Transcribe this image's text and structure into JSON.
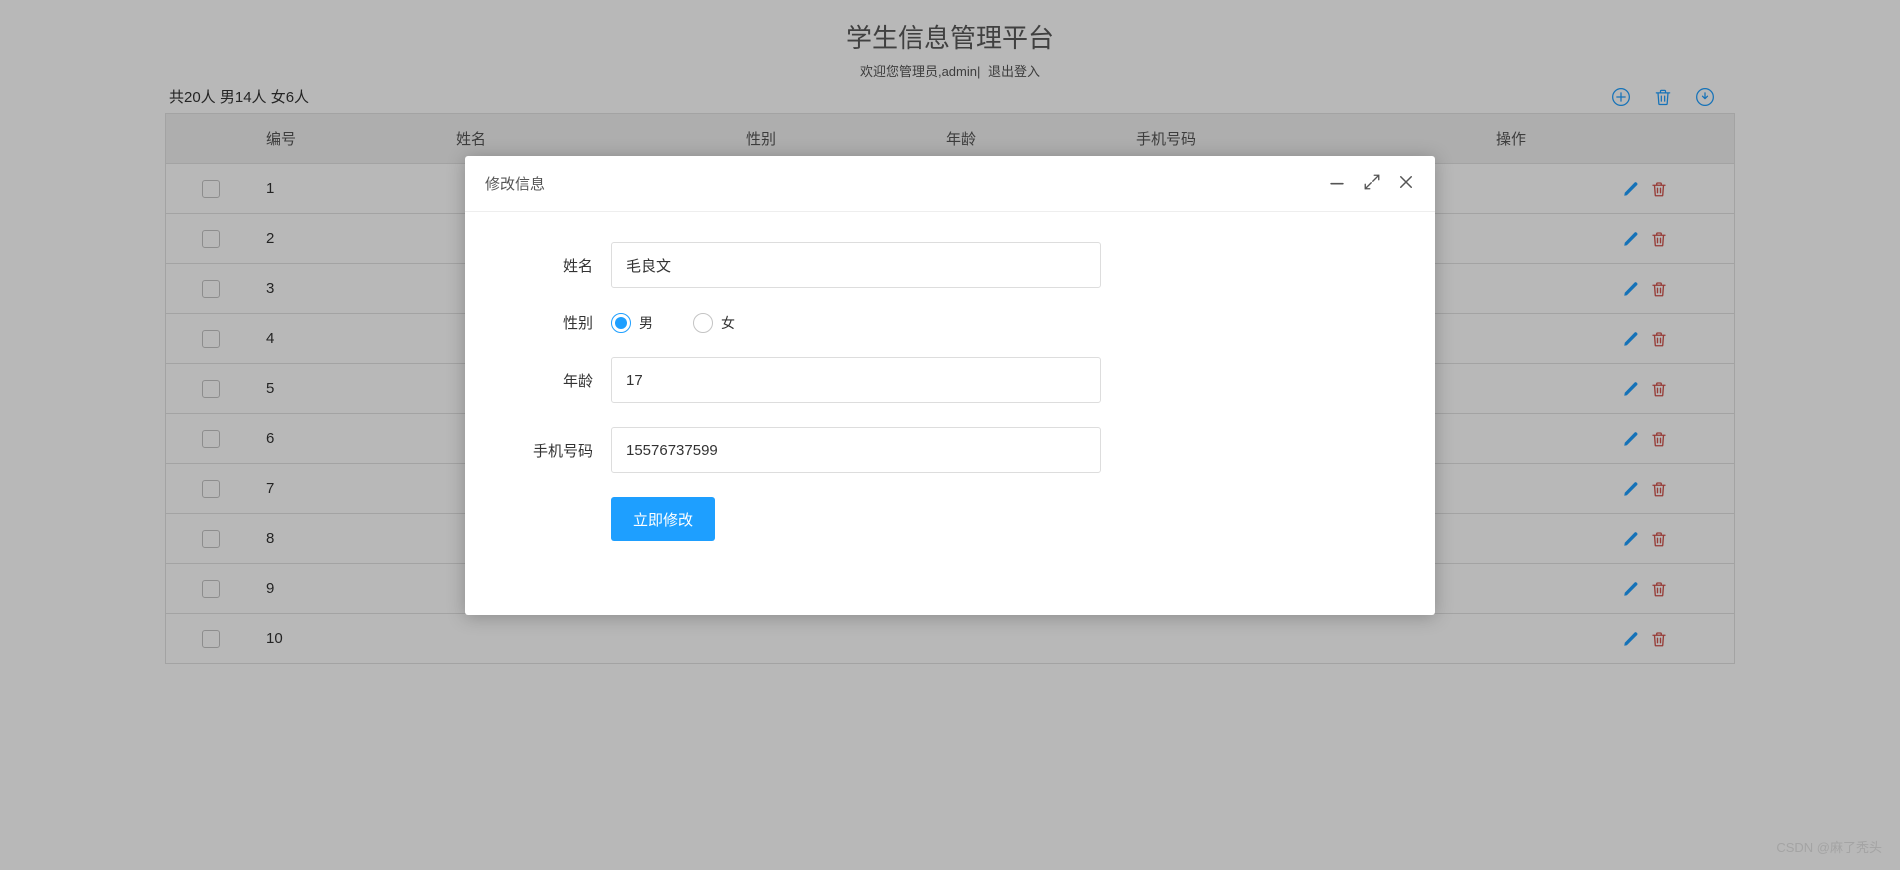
{
  "header": {
    "title": "学生信息管理平台",
    "welcome": "欢迎您管理员,admin|",
    "logout": "退出登入"
  },
  "stats": "共20人 男14人 女6人",
  "table": {
    "columns": {
      "id": "编号",
      "name": "姓名",
      "gender": "性别",
      "age": "年龄",
      "phone": "手机号码",
      "ops": "操作"
    },
    "rows": [
      {
        "id": "1"
      },
      {
        "id": "2"
      },
      {
        "id": "3"
      },
      {
        "id": "4"
      },
      {
        "id": "5"
      },
      {
        "id": "6"
      },
      {
        "id": "7"
      },
      {
        "id": "8"
      },
      {
        "id": "9"
      },
      {
        "id": "10"
      }
    ]
  },
  "modal": {
    "title": "修改信息",
    "form": {
      "name_label": "姓名",
      "name_value": "毛良文",
      "gender_label": "性别",
      "gender_options": {
        "male": "男",
        "female": "女"
      },
      "gender_selected": "male",
      "age_label": "年龄",
      "age_value": "17",
      "phone_label": "手机号码",
      "phone_value": "15576737599",
      "submit": "立即修改"
    }
  },
  "watermark": "CSDN @麻了秃头"
}
